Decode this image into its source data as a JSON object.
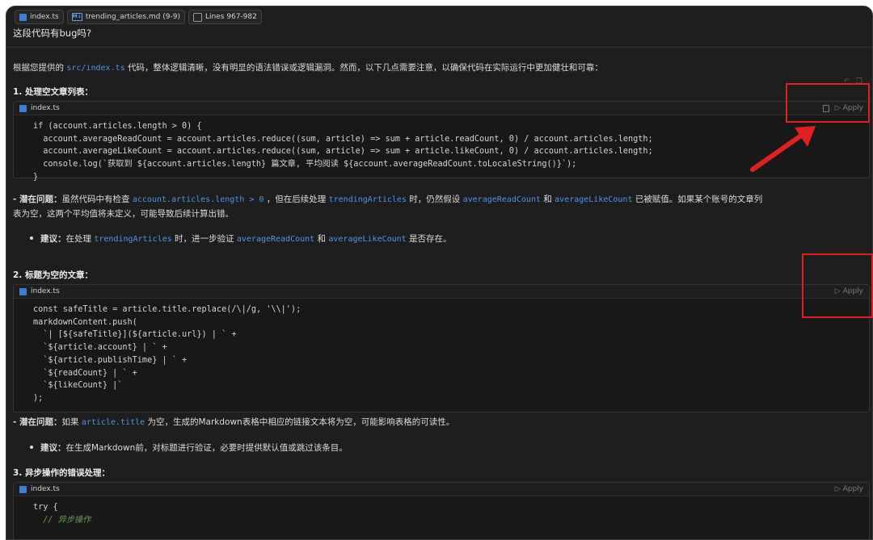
{
  "context": {
    "file1": "index.ts",
    "file2": "trending_articles.md (9-9)",
    "lines": "Lines 967-982"
  },
  "question": "这段代码有bug吗?",
  "intro": {
    "before": "根据您提供的",
    "path": "src/index.ts",
    "after": "代码，整体逻辑清晰，没有明显的语法错误或逻辑漏洞。然而，以下几点需要注意，以确保代码在实际运行中更加健壮和可靠："
  },
  "section1": {
    "title": "1. 处理空文章列表：",
    "file": "index.ts",
    "apply": "Apply",
    "issue": {
      "label": "- 潜在问题：",
      "t1": "虽然代码中有检查",
      "c1": "account.articles.length > 0",
      "t2": "，但在后续处理",
      "c2": "trendingArticles",
      "t3": "时，仍然假设",
      "c3": "averageReadCount",
      "t4": "和",
      "c4": "averageLikeCount",
      "t5": "已被赋值。如果某个账号的文章列",
      "line2": "表为空，这两个平均值将未定义，可能导致后续计算出错。"
    },
    "suggest": {
      "label": "建议：",
      "t1": "在处理",
      "c1": "trendingArticles",
      "t2": "时，进一步验证",
      "c2": "averageReadCount",
      "t3": "和",
      "c3": "averageLikeCount",
      "t4": "是否存在。"
    }
  },
  "section2": {
    "title": "2. 标题为空的文章：",
    "file": "index.ts",
    "apply": "Apply",
    "issue": {
      "label": "- 潜在问题：",
      "t1": "如果",
      "c1": "article.title",
      "t2": "为空，生成的Markdown表格中相应的链接文本将为空，可能影响表格的可读性。"
    },
    "suggest": {
      "label": "建议：",
      "t1": "在生成Markdown前，对标题进行验证，必要时提供默认值或跳过该条目。"
    }
  },
  "section3": {
    "title": "3. 异步操作的错误处理：",
    "file": "index.ts",
    "apply": "Apply"
  },
  "code1": [
    "if (account.articles.length > 0) {",
    "  account.averageReadCount = account.articles.reduce((sum, article) => sum + article.readCount, 0) / account.articles.length;",
    "  account.averageLikeCount = account.articles.reduce((sum, article) => sum + article.likeCount, 0) / account.articles.length;",
    "  console.log(`获取到 ${account.articles.length} 篇文章, 平均阅读 ${account.averageReadCount.toLocaleString()}`);",
    "}"
  ],
  "code2": [
    "const safeTitle = article.title.replace(/\\|/g, '\\\\|');",
    "markdownContent.push(",
    "  `| [${safeTitle}](${article.url}) | ` +",
    "  `${article.account} | ` +",
    "  `${article.publishTime} | ` +",
    "  `${readCount} | ` +",
    "  `${likeCount} |`",
    ");"
  ],
  "code3": [
    "try {",
    "  // 异步操作"
  ],
  "colors": {
    "accent": "#4e94e6",
    "highlight": "#e02020"
  }
}
